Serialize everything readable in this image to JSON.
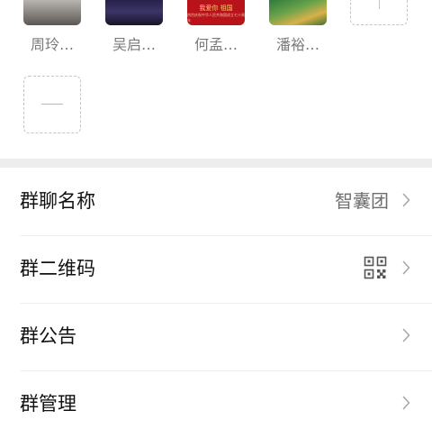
{
  "members": [
    {
      "name": "周玲…",
      "avatar": "photo-avatar-woman"
    },
    {
      "name": "吴启…",
      "avatar": "photo-avatar-night-scene"
    },
    {
      "name": "何孟…",
      "avatar": "red-banner-avatar",
      "avatar_title": "我爱你 祖国",
      "avatar_caption": "热烈庆祝中华人民共和国成立七十周年"
    },
    {
      "name": "潘裕…",
      "avatar": "photo-avatar-garden"
    }
  ],
  "add_member_icon": "plus-icon",
  "remove_member_icon": "minus-icon",
  "settings": {
    "group_name_label": "群聊名称",
    "group_name_value": "智囊团",
    "qr_code_label": "群二维码",
    "announcement_label": "群公告",
    "management_label": "群管理"
  },
  "colors": {
    "text_primary": "#111111",
    "text_secondary": "#6f6f6f",
    "section_divider": "#ededed",
    "dashed_border": "#c4c4c4"
  }
}
